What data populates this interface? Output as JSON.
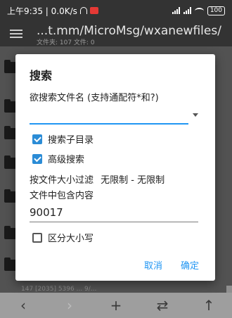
{
  "status_bar": {
    "time_speed": "上午9:35 | 0.0K/s",
    "signal_text": "5G",
    "battery": "100"
  },
  "toolbar": {
    "path_title": "...t.mm/MicroMsg/wxanewfiles/",
    "path_subtitle": "文件夹: 107  文件: 0"
  },
  "background_list": {
    "partial_line": "147  [2035] 5396 ... 9/..."
  },
  "dialog": {
    "title": "搜索",
    "name_label": "欲搜索文件名 (支持通配符*和?)",
    "name_value": "",
    "subdir_label": "搜索子目录",
    "subdir_checked": true,
    "advanced_label": "高级搜索",
    "advanced_checked": true,
    "size_filter_label": "按文件大小过滤",
    "size_filter_value": "无限制 - 无限制",
    "content_label": "文件中包含内容",
    "content_value": "90017",
    "case_label": "区分大小写",
    "case_checked": false,
    "cancel_label": "取消",
    "ok_label": "确定"
  },
  "bottom_bar": {
    "back": "‹",
    "forward": "›",
    "add": "+",
    "swap": "⇄",
    "up": "↑"
  },
  "colors": {
    "accent": "#2196f3",
    "checkbox": "#2b8cd6"
  }
}
